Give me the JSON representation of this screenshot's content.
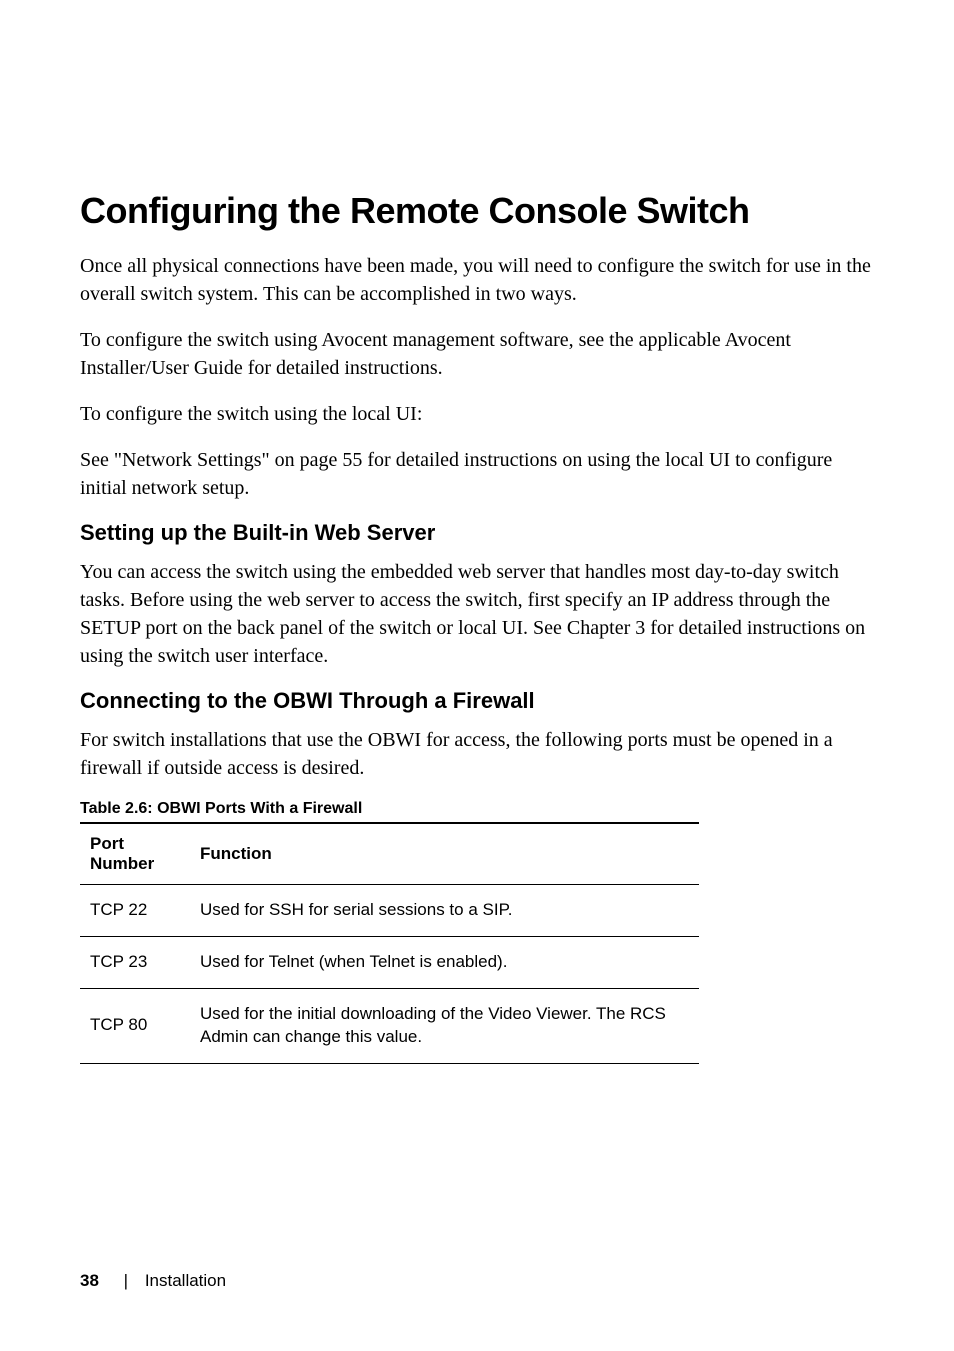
{
  "heading": "Configuring the Remote Console Switch",
  "paragraphs": {
    "p1": "Once all physical connections have been made, you will need to configure the switch for use in the overall switch system. This can be accomplished in two ways.",
    "p2": "To configure the switch using Avocent management software, see the applicable Avocent Installer/User Guide for detailed instructions.",
    "p3": "To configure the switch using the local UI:",
    "p4": "See \"Network Settings\" on page 55 for detailed instructions on using the local UI to configure initial network setup."
  },
  "section1": {
    "heading": "Setting up the Built-in Web Server",
    "p1": "You can access the switch using the embedded web server that handles most day-to-day switch tasks. Before using the web server to access the switch, first specify an IP address through the SETUP port on the back panel of the switch or local UI. See Chapter 3 for detailed instructions on using the switch user interface."
  },
  "section2": {
    "heading": "Connecting to the OBWI Through a Firewall",
    "p1": "For switch installations that use the OBWI for access, the following ports must be opened in a firewall if outside access is desired."
  },
  "table": {
    "caption": "Table 2.6: OBWI Ports With a Firewall",
    "headers": {
      "col1": "Port Number",
      "col2": "Function"
    },
    "rows": [
      {
        "port": "TCP 22",
        "function": "Used for SSH for serial sessions to a SIP."
      },
      {
        "port": "TCP 23",
        "function": "Used for Telnet (when Telnet is enabled)."
      },
      {
        "port": "TCP 80",
        "function": "Used for the initial downloading of the Video Viewer. The RCS Admin can change this value."
      }
    ]
  },
  "footer": {
    "page": "38",
    "section": "Installation"
  }
}
